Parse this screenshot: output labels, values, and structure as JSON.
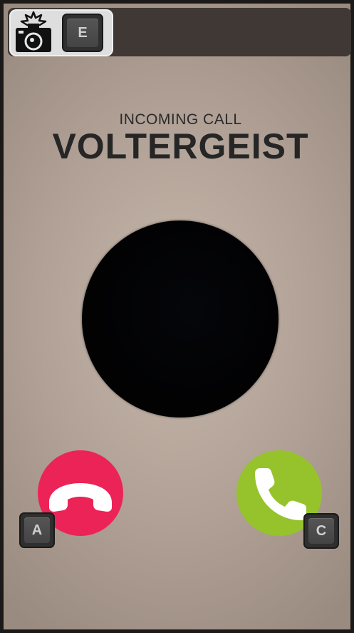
{
  "toolbar": {
    "camera_icon": "camera-flash-icon",
    "camera_key": "E"
  },
  "call": {
    "status_label": "INCOMING CALL",
    "caller_name": "VOLTERGEIST"
  },
  "actions": {
    "decline_icon": "phone-hangup-icon",
    "decline_key": "A",
    "accept_icon": "phone-answer-icon",
    "accept_key": "C",
    "decline_color": "#ec2356",
    "accept_color": "#96c32c"
  }
}
